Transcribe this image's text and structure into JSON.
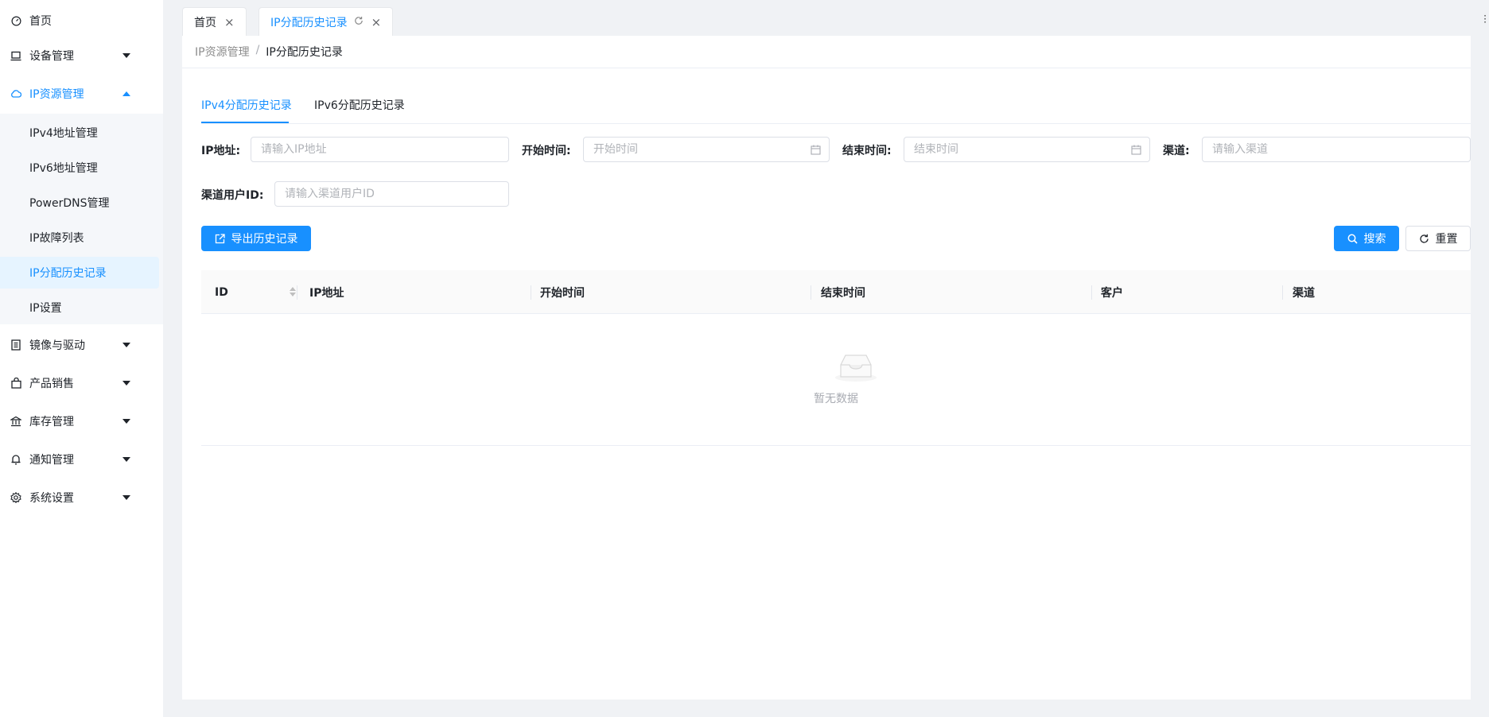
{
  "sidebar": {
    "items": [
      {
        "label": "首页",
        "icon": "dashboard-icon"
      },
      {
        "label": "设备管理",
        "icon": "laptop-icon"
      },
      {
        "label": "IP资源管理",
        "icon": "cloud-icon"
      },
      {
        "label": "镜像与驱动",
        "icon": "book-icon"
      },
      {
        "label": "产品销售",
        "icon": "shopping-bag-icon"
      },
      {
        "label": "库存管理",
        "icon": "bank-icon"
      },
      {
        "label": "通知管理",
        "icon": "bell-icon"
      },
      {
        "label": "系统设置",
        "icon": "gear-icon"
      }
    ],
    "submenu": [
      {
        "label": "IPv4地址管理"
      },
      {
        "label": "IPv6地址管理"
      },
      {
        "label": "PowerDNS管理"
      },
      {
        "label": "IP故障列表"
      },
      {
        "label": "IP分配历史记录"
      },
      {
        "label": "IP设置"
      }
    ]
  },
  "tabs": [
    {
      "label": "首页"
    },
    {
      "label": "IP分配历史记录"
    }
  ],
  "breadcrumb": {
    "parent": "IP资源管理",
    "separator": "/",
    "current": "IP分配历史记录"
  },
  "subtabs": [
    {
      "label": "IPv4分配历史记录"
    },
    {
      "label": "IPv6分配历史记录"
    }
  ],
  "filters": {
    "ip_label": "IP地址:",
    "ip_placeholder": "请输入IP地址",
    "start_label": "开始时间:",
    "start_placeholder": "开始时间",
    "end_label": "结束时间:",
    "end_placeholder": "结束时间",
    "channel_label": "渠道:",
    "channel_placeholder": "请输入渠道",
    "channel_user_label": "渠道用户ID:",
    "channel_user_placeholder": "请输入渠道用户ID"
  },
  "actions": {
    "export_label": "导出历史记录",
    "search_label": "搜索",
    "reset_label": "重置"
  },
  "table": {
    "columns": [
      "ID",
      "IP地址",
      "开始时间",
      "结束时间",
      "客户",
      "渠道"
    ],
    "empty_text": "暂无数据"
  },
  "colors": {
    "accent": "#1890ff",
    "selected_bg": "#e6f4ff"
  }
}
